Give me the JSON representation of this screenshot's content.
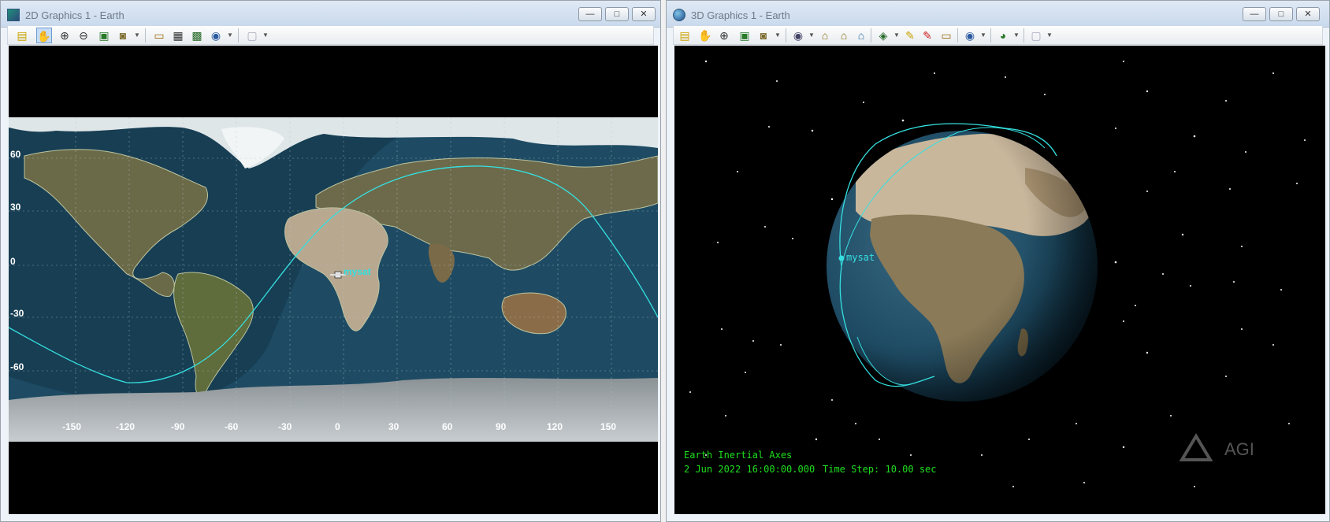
{
  "window2d": {
    "title": "2D Graphics 1 - Earth",
    "map": {
      "lat_labels": [
        "60",
        "30",
        "0",
        "-30",
        "-60"
      ],
      "lon_labels": [
        "-150",
        "-120",
        "-90",
        "-60",
        "-30",
        "0",
        "30",
        "60",
        "90",
        "120",
        "150"
      ],
      "satellite_label": "mysat"
    }
  },
  "window3d": {
    "title": "3D Graphics 1 - Earth",
    "satellite_label": "mysat",
    "axes_text": "Earth Inertial Axes",
    "date_text": "2 Jun 2022 16:00:00.000",
    "timestep_text": "Time Step: 10.00 sec",
    "watermark": "AGI"
  },
  "window_buttons": {
    "minimize": "—",
    "maximize": "□",
    "close": "✕"
  },
  "colors": {
    "orbit": "#35e0e0",
    "overlay_text": "#1ee01e",
    "ocean": "#1d4a62",
    "land": "#6d6a4c"
  }
}
